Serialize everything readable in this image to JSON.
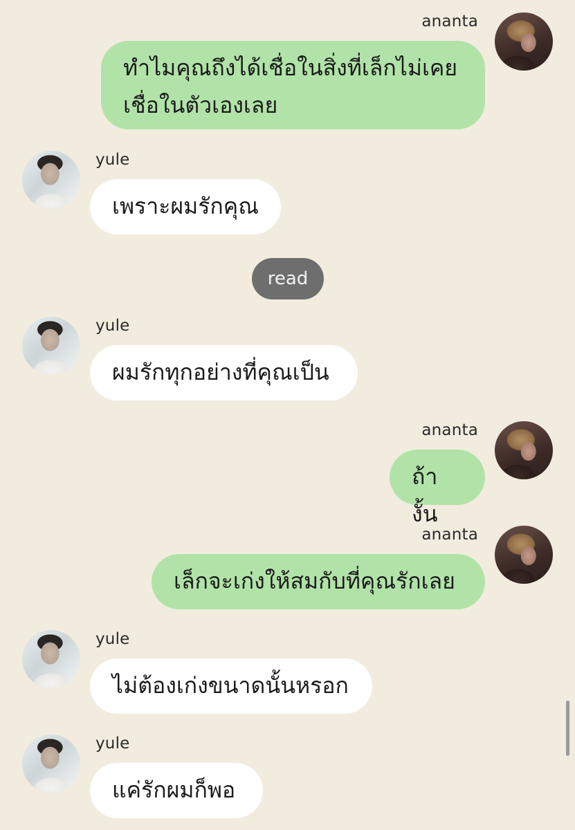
{
  "chat": {
    "messages": [
      {
        "sender": "ananta",
        "side": "right",
        "text": "ทำไมคุณถึงได้เชื่อในสิ่งที่เล็กไม่เคย\nเชื่อในตัวเองเลย"
      },
      {
        "sender": "yule",
        "side": "left",
        "text": "เพราะผมรักคุณ"
      },
      {
        "sender": "yule",
        "side": "left",
        "text": "ผมรักทุกอย่างที่คุณเป็น"
      },
      {
        "sender": "ananta",
        "side": "right",
        "text": "ถ้างั้น"
      },
      {
        "sender": "ananta",
        "side": "right",
        "text": "เล็กจะเก่งให้สมกับที่คุณรักเลย"
      },
      {
        "sender": "yule",
        "side": "left",
        "text": "ไม่ต้องเก่งขนาดนั้นหรอก"
      },
      {
        "sender": "yule",
        "side": "left",
        "text": "แค่รักผมก็พอ"
      }
    ],
    "read_label": "read"
  },
  "colors": {
    "background": "#f2ecdf",
    "incoming_bubble": "#ffffff",
    "outgoing_bubble": "#b1e3a8",
    "read_pill": "#6e6e6e"
  }
}
